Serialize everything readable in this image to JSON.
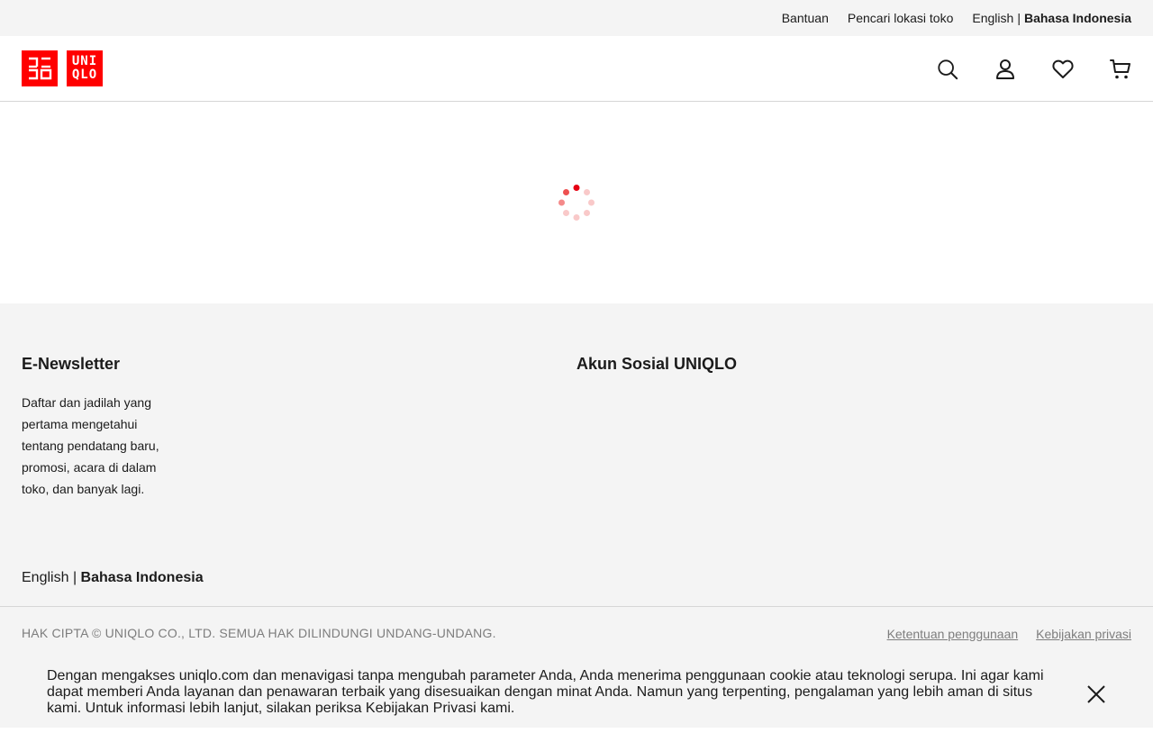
{
  "utility_bar": {
    "help_label": "Bantuan",
    "store_locator_label": "Pencari lokasi toko",
    "lang_english": "English",
    "lang_separator": "|",
    "lang_indonesian": "Bahasa Indonesia"
  },
  "header": {
    "logo_top": "ユニクロ",
    "logo_bottom_line1": "UNI",
    "logo_bottom_line2": "QLO",
    "icons": [
      "search-icon",
      "account-icon",
      "wishlist-heart-icon",
      "cart-icon"
    ]
  },
  "main": {
    "loading_indicator": "spinner-icon"
  },
  "footer": {
    "newsletter_title": "E-Newsletter",
    "newsletter_text": "Daftar dan jadilah yang pertama mengetahui tentang pendatang baru, promosi, acara di dalam toko, dan banyak lagi.",
    "social_title": "Akun Sosial UNIQLO",
    "lang_english": "English",
    "lang_separator": "|",
    "lang_indonesian": "Bahasa Indonesia",
    "copyright": "HAK CIPTA © UNIQLO CO., LTD. SEMUA HAK DILINDUNGI UNDANG-UNDANG.",
    "terms_label": "Ketentuan penggunaan",
    "privacy_label": "Kebijakan privasi"
  },
  "cookie_banner": {
    "text": "Dengan mengakses uniqlo.com dan menavigasi tanpa mengubah parameter Anda, Anda menerima penggunaan cookie atau teknologi serupa. Ini agar kami dapat memberi Anda layanan dan penawaran terbaik yang disesuaikan dengan minat Anda. Namun yang terpenting, pengalaman yang lebih aman di situs kami. Untuk informasi lebih lanjut, silakan periksa Kebijakan Privasi kami.",
    "close_icon": "close-icon"
  },
  "colors": {
    "brand_red": "#ff0000",
    "background_gray": "#f4f4f4",
    "text": "#1b1b1b",
    "muted_text": "#7d7d7d"
  }
}
